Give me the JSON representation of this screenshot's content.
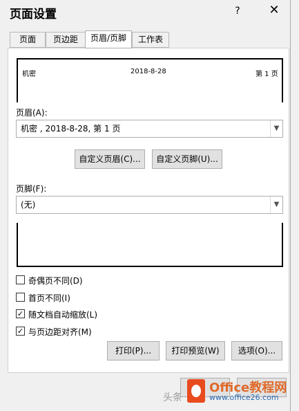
{
  "dialog": {
    "title": "页面设置",
    "help": "?",
    "close": "✕"
  },
  "tabs": [
    {
      "label": "页面"
    },
    {
      "label": "页边距"
    },
    {
      "label": "页眉/页脚"
    },
    {
      "label": "工作表"
    }
  ],
  "header_preview": {
    "left": "机密",
    "center": "2018-8-28",
    "right": "第 1 页"
  },
  "header": {
    "label": "页眉(A):",
    "value": "机密 , 2018-8-28,  第 1 页"
  },
  "custom_buttons": {
    "custom_header": "自定义页眉(C)...",
    "custom_footer": "自定义页脚(U)..."
  },
  "footer": {
    "label": "页脚(F):",
    "value": "(无)"
  },
  "options": [
    {
      "label": "奇偶页不同(D)",
      "checked": false
    },
    {
      "label": "首页不同(I)",
      "checked": false
    },
    {
      "label": "随文档自动缩放(L)",
      "checked": true
    },
    {
      "label": "与页边距对齐(M)",
      "checked": true
    }
  ],
  "action_buttons": {
    "print": "打印(P)...",
    "print_preview": "打印预览(W)",
    "options": "选项(O)..."
  },
  "logo": {
    "name": "Office教程网",
    "url": "www.office26.com"
  },
  "watermark": "头条"
}
